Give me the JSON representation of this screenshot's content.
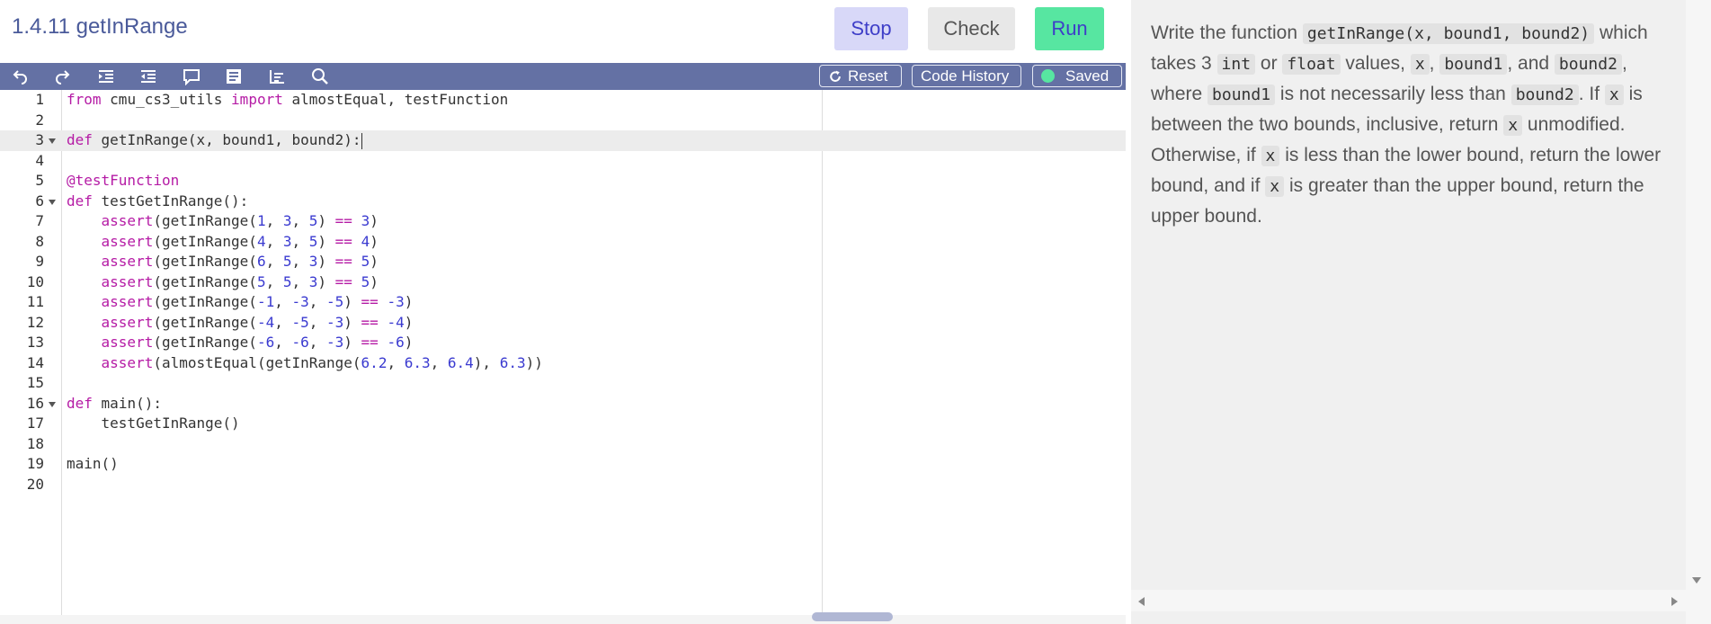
{
  "header": {
    "title": "1.4.11 getInRange",
    "stop_label": "Stop",
    "check_label": "Check",
    "run_label": "Run"
  },
  "toolbar": {
    "icons": [
      "undo-icon",
      "redo-icon",
      "indent-icon",
      "outdent-icon",
      "comment-icon",
      "format-icon",
      "list-icon",
      "search-icon"
    ],
    "reset_label": "Reset",
    "history_label": "Code History",
    "saved_label": "Saved",
    "bar_color": "#6471a4",
    "saved_dot_color": "#57e6a1"
  },
  "editor": {
    "active_line": 3,
    "lines": [
      {
        "n": "1",
        "foldable": false,
        "text": "from cmu_cs3_utils import almostEqual, testFunction"
      },
      {
        "n": "2",
        "foldable": false,
        "text": ""
      },
      {
        "n": "3",
        "foldable": true,
        "text": "def getInRange(x, bound1, bound2):"
      },
      {
        "n": "4",
        "foldable": false,
        "text": ""
      },
      {
        "n": "5",
        "foldable": false,
        "text": "@testFunction"
      },
      {
        "n": "6",
        "foldable": true,
        "text": "def testGetInRange():"
      },
      {
        "n": "7",
        "foldable": false,
        "text": "    assert(getInRange(1, 3, 5) == 3)"
      },
      {
        "n": "8",
        "foldable": false,
        "text": "    assert(getInRange(4, 3, 5) == 4)"
      },
      {
        "n": "9",
        "foldable": false,
        "text": "    assert(getInRange(6, 5, 3) == 5)"
      },
      {
        "n": "10",
        "foldable": false,
        "text": "    assert(getInRange(5, 5, 3) == 5)"
      },
      {
        "n": "11",
        "foldable": false,
        "text": "    assert(getInRange(-1, -3, -5) == -3)"
      },
      {
        "n": "12",
        "foldable": false,
        "text": "    assert(getInRange(-4, -5, -3) == -4)"
      },
      {
        "n": "13",
        "foldable": false,
        "text": "    assert(getInRange(-6, -6, -3) == -6)"
      },
      {
        "n": "14",
        "foldable": false,
        "text": "    assert(almostEqual(getInRange(6.2, 6.3, 6.4), 6.3))"
      },
      {
        "n": "15",
        "foldable": false,
        "text": ""
      },
      {
        "n": "16",
        "foldable": true,
        "text": "def main():"
      },
      {
        "n": "17",
        "foldable": false,
        "text": "    testGetInRange()"
      },
      {
        "n": "18",
        "foldable": false,
        "text": ""
      },
      {
        "n": "19",
        "foldable": false,
        "text": "main()"
      },
      {
        "n": "20",
        "foldable": false,
        "text": ""
      }
    ]
  },
  "description": {
    "segments": [
      {
        "t": "Write the function "
      },
      {
        "c": "getInRange(x, bound1, bound2)"
      },
      {
        "t": " which takes 3 "
      },
      {
        "c": "int"
      },
      {
        "t": " or "
      },
      {
        "c": "float"
      },
      {
        "t": " values, "
      },
      {
        "c": "x"
      },
      {
        "t": ", "
      },
      {
        "c": "bound1"
      },
      {
        "t": ", and "
      },
      {
        "c": "bound2"
      },
      {
        "t": ", where "
      },
      {
        "c": "bound1"
      },
      {
        "t": " is not necessarily less than "
      },
      {
        "c": "bound2"
      },
      {
        "t": ". If "
      },
      {
        "c": "x"
      },
      {
        "t": " is between the two bounds, inclusive, return "
      },
      {
        "c": "x"
      },
      {
        "t": " unmodified. Otherwise, if "
      },
      {
        "c": "x"
      },
      {
        "t": " is less than the lower bound, return the lower bound, and if "
      },
      {
        "c": "x"
      },
      {
        "t": " is greater than the upper bound, return the upper bound."
      }
    ]
  }
}
